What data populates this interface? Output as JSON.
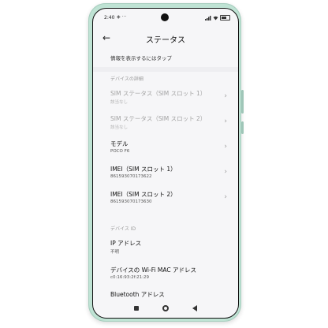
{
  "statusbar": {
    "time": "2:40",
    "left_icons": "◈ ···"
  },
  "header": {
    "title": "ステータス",
    "back_icon": "←"
  },
  "hint": "情報を表示するにはタップ",
  "section_device": "デバイスの詳細",
  "rows": [
    {
      "label": "SIM ステータス（SIM スロット 1）",
      "sub": "該当なし"
    },
    {
      "label": "SIM ステータス（SIM スロット 2）",
      "sub": "該当なし"
    },
    {
      "label": "モデル",
      "sub": "POCO F6"
    },
    {
      "label": "IMEI（SIM スロット 1）",
      "sub": "861593070173622"
    },
    {
      "label": "IMEI（SIM スロット 2）",
      "sub": "861593070173630"
    }
  ],
  "section_id": "デバイス ID",
  "rows2": [
    {
      "label": "IP アドレス",
      "sub": "不明"
    },
    {
      "label": "デバイスの Wi-Fi MAC アドレス",
      "sub": "c0:16:93:2f:21:29"
    },
    {
      "label": "Bluetooth アドレス",
      "sub": ""
    }
  ],
  "chevron": "›",
  "colors": {
    "phone_body": "#bfe3d4",
    "screen_bg": "#f6f6f8",
    "disabled_text": "#a2a2a2"
  }
}
